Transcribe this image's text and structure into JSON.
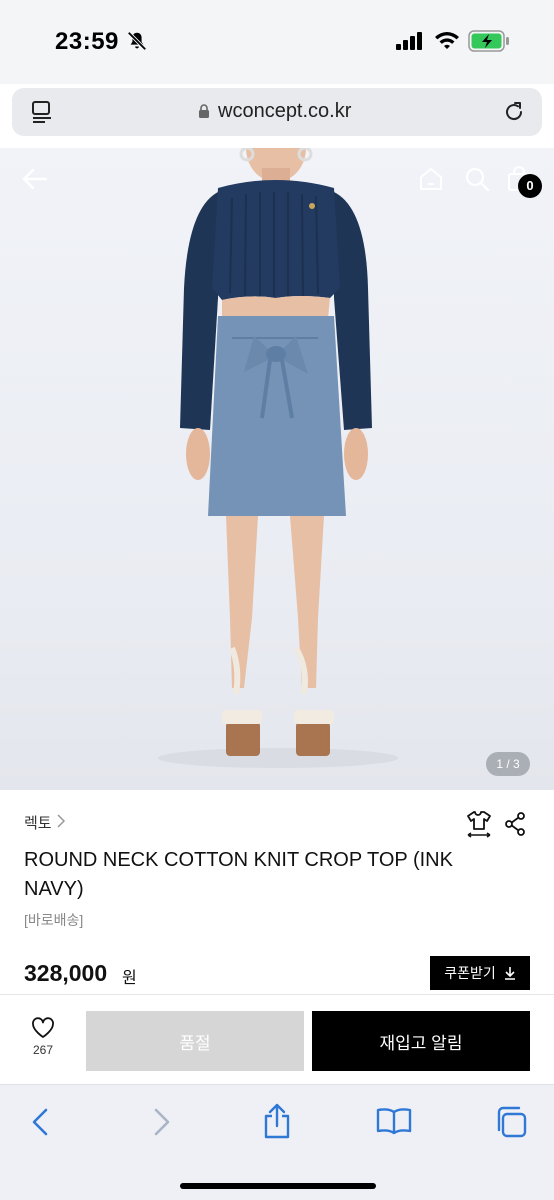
{
  "status_bar": {
    "time": "23:59"
  },
  "browser": {
    "url": "wconcept.co.kr"
  },
  "hero": {
    "page_indicator": "1 / 3",
    "cart_count": "0"
  },
  "product": {
    "brand": "렉토",
    "title": "ROUND NECK COTTON KNIT CROP TOP (INK NAVY)",
    "shipping_tag": "[바로배송]",
    "price": "328,000",
    "price_unit": "원",
    "coupon_label": "쿠폰받기"
  },
  "actions": {
    "wish_count": "267",
    "soldout_label": "품절",
    "restock_label": "재입고 알림"
  },
  "icons": {
    "status": [
      "bell-off-icon",
      "signal-icon",
      "wifi-icon",
      "battery-charging-icon"
    ],
    "browser": [
      "reader-icon",
      "lock-icon",
      "reload-icon"
    ],
    "hero": [
      "back-arrow-icon",
      "home-icon",
      "search-icon",
      "shopping-bag-icon"
    ],
    "product": [
      "chevron-right-icon",
      "size-guide-icon",
      "share-icon",
      "download-icon",
      "heart-icon"
    ],
    "toolbar": [
      "chevron-left-icon",
      "chevron-right-icon",
      "share-icon",
      "book-icon",
      "tabs-icon"
    ]
  },
  "colors": {
    "accent": "#000000",
    "soldout": "#d6d6d6",
    "battery": "#34c759",
    "sweater": "#1f3556",
    "skirt": "#7493b6",
    "toolbar_blue": "#2f78d6"
  }
}
